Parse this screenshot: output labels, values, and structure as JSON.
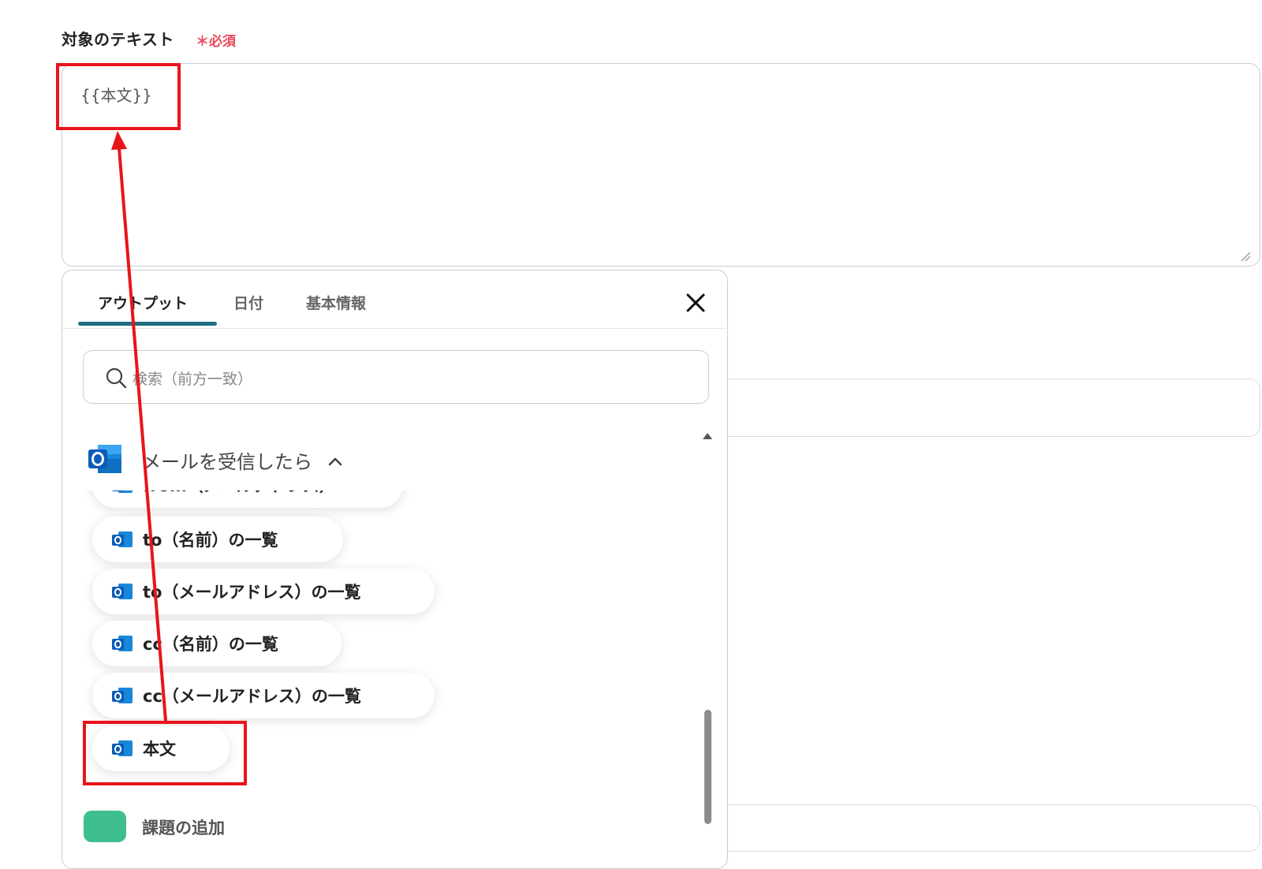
{
  "field": {
    "label": "対象のテキスト",
    "required_mark": "＊必須",
    "value": "{{本文}}"
  },
  "panel": {
    "tabs": [
      {
        "label": "アウトプット",
        "active": true
      },
      {
        "label": "日付",
        "active": false
      },
      {
        "label": "基本情報",
        "active": false
      }
    ],
    "close_icon": "close-icon",
    "search": {
      "placeholder": "検索（前方一致）"
    },
    "section": {
      "title": "メールを受信したら",
      "expanded": true,
      "icon": "outlook-icon"
    },
    "items": [
      {
        "label": "from（メールアドレス）"
      },
      {
        "label": "to（名前）の一覧"
      },
      {
        "label": "to（メールアドレス）の一覧"
      },
      {
        "label": "cc（名前）の一覧"
      },
      {
        "label": "cc（メールアドレス）の一覧"
      },
      {
        "label": "本文",
        "highlighted": true
      }
    ],
    "next_section": {
      "title": "課題の追加"
    }
  },
  "annotation": {
    "color": "#e8141c",
    "arrow": "本文 → 対象のテキスト"
  },
  "colors": {
    "tab_underline": "#1f6f82",
    "required": "#e8465b",
    "outlook_blue": "#0a64c8"
  }
}
